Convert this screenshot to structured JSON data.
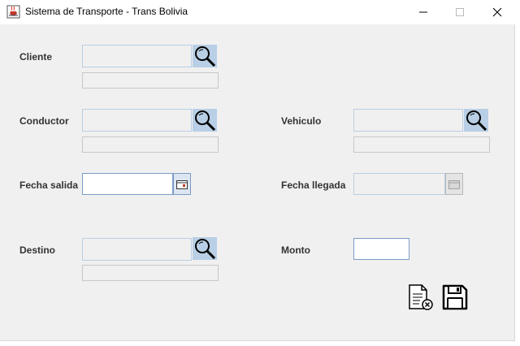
{
  "window": {
    "title": "Sistema de Transporte - Trans Bolivia",
    "icon": "java-cup-icon",
    "controls": [
      "minimize",
      "maximize",
      "close"
    ]
  },
  "form": {
    "cliente": {
      "label": "Cliente",
      "value": "",
      "detail": ""
    },
    "conductor": {
      "label": "Conductor",
      "value": "",
      "detail": ""
    },
    "vehiculo": {
      "label": "Vehiculo",
      "value": "",
      "detail": ""
    },
    "fecha_salida": {
      "label": "Fecha salida",
      "value": ""
    },
    "fecha_llegada": {
      "label": "Fecha llegada",
      "value": ""
    },
    "destino": {
      "label": "Destino",
      "value": "",
      "detail": ""
    },
    "monto": {
      "label": "Monto",
      "value": ""
    }
  },
  "actions": {
    "clear": "document-clear-icon",
    "save": "floppy-disk-icon"
  },
  "colors": {
    "window_bg": "#f0f0f0",
    "field_border": "#b8cfe5",
    "search_button_bg": "#b8cfe5",
    "label_text": "#333333"
  }
}
